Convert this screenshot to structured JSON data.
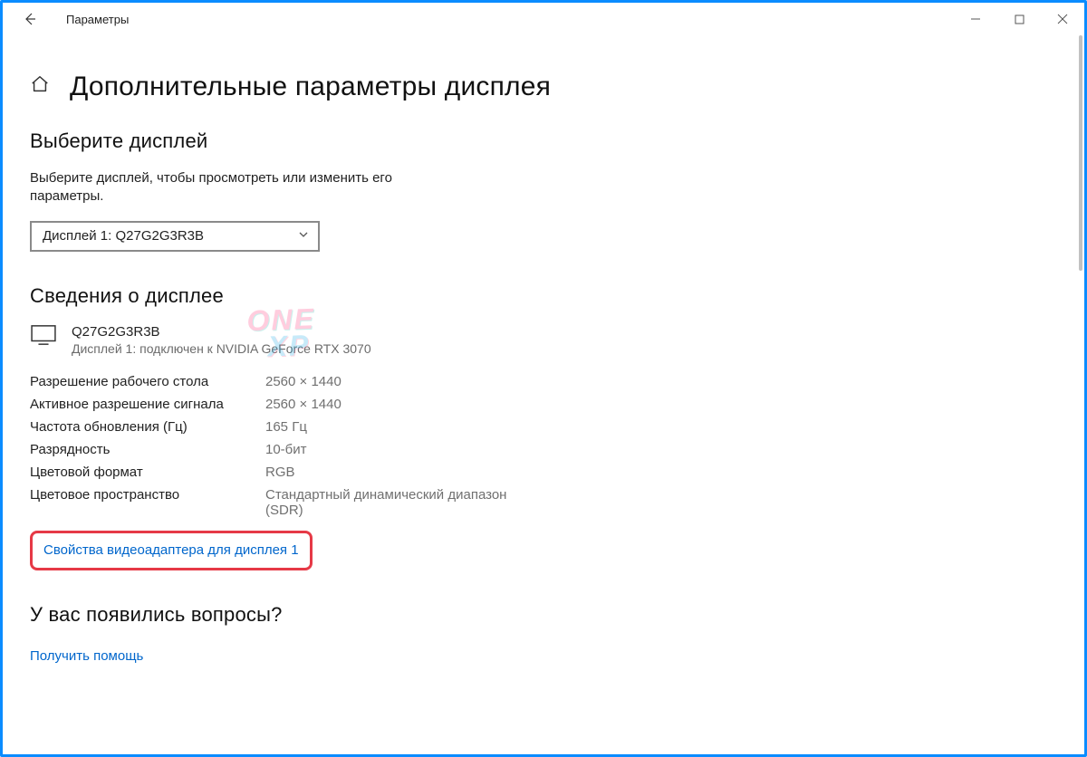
{
  "window": {
    "title": "Параметры"
  },
  "header": {
    "title": "Дополнительные параметры дисплея"
  },
  "select_display": {
    "heading": "Выберите дисплей",
    "description": "Выберите дисплей, чтобы просмотреть или изменить его параметры.",
    "selected": "Дисплей 1: Q27G2G3R3B"
  },
  "display_info": {
    "heading": "Сведения о дисплее",
    "name": "Q27G2G3R3B",
    "subtitle": "Дисплей 1: подключен к NVIDIA GeForce RTX 3070",
    "rows": [
      {
        "label": "Разрешение рабочего стола",
        "value": "2560 × 1440"
      },
      {
        "label": "Активное разрешение сигнала",
        "value": "2560 × 1440"
      },
      {
        "label": "Частота обновления (Гц)",
        "value": "165 Гц"
      },
      {
        "label": "Разрядность",
        "value": "10-бит"
      },
      {
        "label": "Цветовой формат",
        "value": "RGB"
      },
      {
        "label": "Цветовое пространство",
        "value": "Стандартный динамический диапазон (SDR)"
      }
    ],
    "adapter_link": "Свойства видеоадаптера для дисплея 1"
  },
  "help": {
    "heading": "У вас появились вопросы?",
    "link": "Получить помощь"
  },
  "watermark": {
    "line1": "ONE",
    "line2": "XP"
  }
}
